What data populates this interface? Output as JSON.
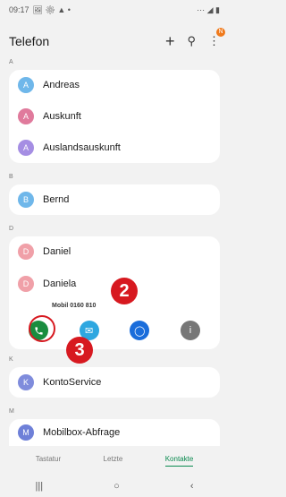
{
  "status_bar": {
    "time": "09:17",
    "left_icons": "🖼 ⚙ ▲ •",
    "right_icons": "⋯ ◢ ▮"
  },
  "header": {
    "title": "Telefon",
    "add_icon": "+",
    "search_icon": "⚲",
    "menu_icon": "⋮",
    "notif_badge": "N"
  },
  "sections": [
    {
      "letter": "A",
      "contacts": [
        {
          "initial": "A",
          "name": "Andreas",
          "color": "#6fb7ea"
        },
        {
          "initial": "A",
          "name": "Auskunft",
          "color": "#e07a9c"
        },
        {
          "initial": "A",
          "name": "Auslandsauskunft",
          "color": "#a58ee3"
        }
      ]
    },
    {
      "letter": "B",
      "contacts": [
        {
          "initial": "B",
          "name": "Bernd",
          "color": "#6fb7ea"
        }
      ]
    },
    {
      "letter": "D",
      "contacts": [
        {
          "initial": "D",
          "name": "Daniel",
          "color": "#f0a0a8"
        },
        {
          "initial": "D",
          "name": "Daniela",
          "color": "#f0a0a8"
        }
      ]
    },
    {
      "letter": "K",
      "contacts": [
        {
          "initial": "K",
          "name": "KontoService",
          "color": "#7f8cdc"
        }
      ]
    },
    {
      "letter": "M",
      "contacts": [
        {
          "initial": "M",
          "name": "Mobilbox-Abfrage",
          "color": "#6e80d8"
        }
      ]
    }
  ],
  "daniela_sub": "Mobil  0160 810",
  "actions": {
    "call_color": "#1a8d3f",
    "message_color": "#2ea7e0",
    "video_color": "#1a6ddb",
    "info_color": "#777777"
  },
  "markers": [
    "2",
    "3"
  ],
  "tabs": [
    "Tastatur",
    "Letzte",
    "Kontakte"
  ],
  "nav": {
    "recent": "|||",
    "home": "○",
    "back": "‹"
  }
}
